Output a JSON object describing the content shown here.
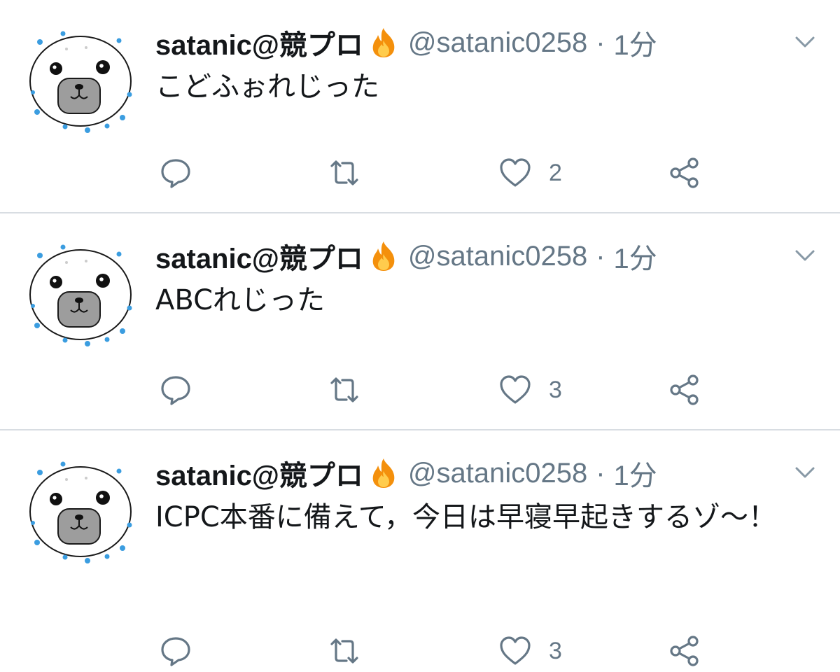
{
  "colors": {
    "text_primary": "#14171a",
    "text_secondary": "#657786",
    "icon_gray": "#657786",
    "divider": "#d8dde2",
    "avatar_accent": "#3b9de0"
  },
  "tweets": [
    {
      "display_name": "satanic@競プロ",
      "name_emoji": "fire-emoji",
      "handle": "@satanic0258",
      "separator": "·",
      "time": "1分",
      "text": "こどふぉれじった",
      "like_count": "2",
      "icons": [
        "reply-icon",
        "retweet-icon",
        "like-icon",
        "share-icon",
        "chevron-down-icon"
      ]
    },
    {
      "display_name": "satanic@競プロ",
      "name_emoji": "fire-emoji",
      "handle": "@satanic0258",
      "separator": "·",
      "time": "1分",
      "text": "ABCれじった",
      "like_count": "3",
      "icons": [
        "reply-icon",
        "retweet-icon",
        "like-icon",
        "share-icon",
        "chevron-down-icon"
      ]
    },
    {
      "display_name": "satanic@競プロ",
      "name_emoji": "fire-emoji",
      "handle": "@satanic0258",
      "separator": "·",
      "time": "1分",
      "text": "ICPC本番に備えて，今日は早寝早起きするゾ〜！",
      "like_count": "3",
      "icons": [
        "reply-icon",
        "retweet-icon",
        "like-icon",
        "share-icon",
        "chevron-down-icon"
      ]
    }
  ]
}
